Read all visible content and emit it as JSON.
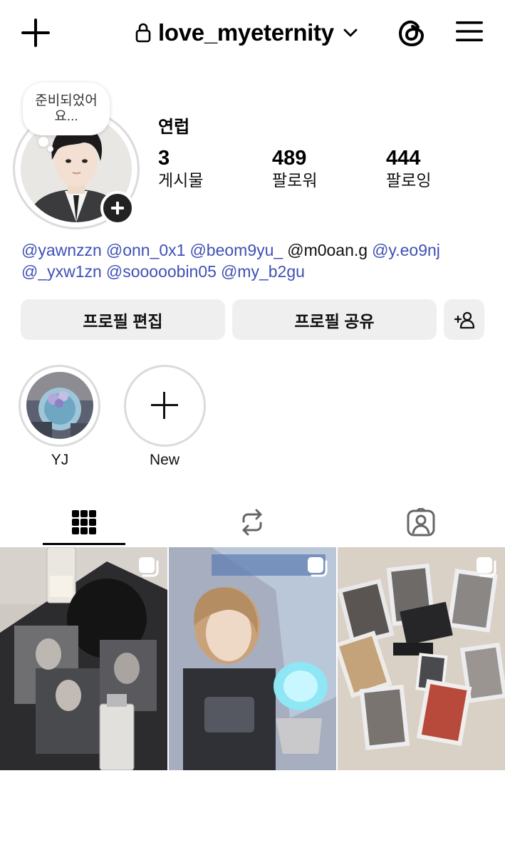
{
  "header": {
    "username": "love_myeternity",
    "icons": [
      "plus-icon",
      "lock-icon",
      "chevron-down-icon",
      "threads-icon",
      "menu-icon"
    ]
  },
  "profile": {
    "note": "준비되었어요...",
    "display_name": "연럽",
    "stats": [
      {
        "value": "3",
        "label": "게시물"
      },
      {
        "value": "489",
        "label": "팔로워"
      },
      {
        "value": "444",
        "label": "팔로잉"
      }
    ],
    "bio": [
      {
        "text": "@yawnzzn",
        "link": true
      },
      {
        "text": "@onn_0x1",
        "link": true
      },
      {
        "text": "@beom9yu_",
        "link": true
      },
      {
        "text": "@m0oan.g",
        "link": false
      },
      {
        "text": "@y.eo9nj",
        "link": true
      },
      {
        "text": "@_yxw1zn",
        "link": true
      },
      {
        "text": "@sooooobin05",
        "link": true
      },
      {
        "text": "@my_b2gu",
        "link": true
      }
    ]
  },
  "buttons": {
    "edit": "프로필 편집",
    "share": "프로필 공유",
    "add_icon": "person-add-icon"
  },
  "highlights": [
    {
      "label": "YJ"
    },
    {
      "label": "New"
    }
  ],
  "tabs": [
    {
      "name": "posts-grid",
      "icon": "grid-icon",
      "active": true
    },
    {
      "name": "reposts",
      "icon": "repost-icon",
      "active": false
    },
    {
      "name": "tagged",
      "icon": "tagged-person-icon",
      "active": false
    }
  ],
  "posts": [
    {
      "type": "carousel",
      "icon": "multiple-posts-icon"
    },
    {
      "type": "carousel",
      "icon": "multiple-posts-icon"
    },
    {
      "type": "carousel",
      "icon": "multiple-posts-icon"
    }
  ],
  "colors": {
    "mention": "#3f51b5",
    "button_bg": "#efeff0",
    "ring": "#dbdbdb"
  }
}
